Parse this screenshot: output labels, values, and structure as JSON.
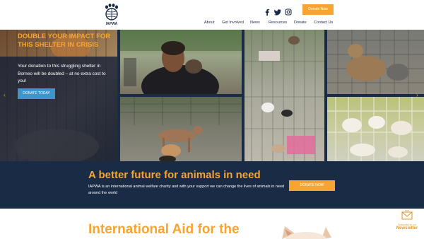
{
  "header": {
    "logo_text": "IAPWA",
    "donate_label": "Donate Now",
    "social_icons": [
      "facebook-icon",
      "twitter-icon",
      "instagram-icon"
    ],
    "nav": [
      "About",
      "Get Involved",
      "News",
      "Resources",
      "Donate",
      "Contact Us"
    ]
  },
  "hero": {
    "headline": "DOUBLE YOUR IMPACT FOR THIS SHELTER IN CRISIS",
    "body": "Your donation to this struggling shelter in Borneo will be doubled – at no extra cost to you!",
    "button": "DONATE TODAY",
    "prev_arrow": "‹",
    "next_arrow": "›"
  },
  "band": {
    "title": "A better future for animals in need",
    "text": "IAPWA is an international animal welfare charity and with your support we can change the lives of animals in need around the world",
    "button": "DONATE NOW"
  },
  "bottom": {
    "title": "International Aid for the"
  },
  "newsletter": {
    "small": "Subscribe to our",
    "big": "Newsletter"
  },
  "colors": {
    "accent": "#f6a532",
    "navy": "#1a2b45",
    "blue_button": "#3d95c8"
  }
}
